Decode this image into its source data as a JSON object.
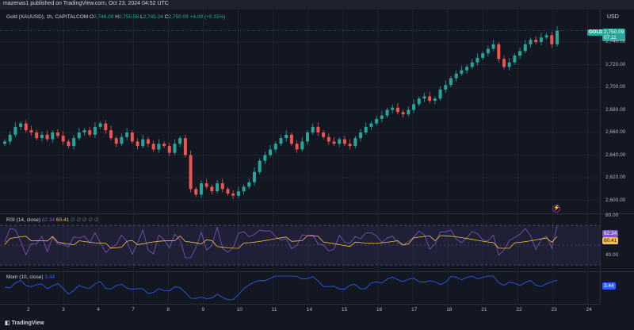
{
  "header": {
    "publisher": "mazenas1 published on TradingView.com, Oct 23, 2024 04:52 UTC"
  },
  "main_legend": {
    "symbol": "Gold (XAUUSD), 1h, CAPITALCOM",
    "o_label": "O",
    "o": "2,746.00",
    "h_label": "H",
    "h": "2,750.58",
    "l_label": "L",
    "l": "2,745.24",
    "c_label": "C",
    "c": "2,750.09",
    "change": "+4.09 (+0.15%)"
  },
  "currency": "USD",
  "symbol_tag": "GOLD",
  "current_price": "2,750.09",
  "countdown": "07:11",
  "price_axis": [
    "2,740.00",
    "2,720.00",
    "2,700.00",
    "2,680.00",
    "2,660.00",
    "2,640.00",
    "2,620.00",
    "2,600.00"
  ],
  "rsi": {
    "legend": "RSI (14, close)",
    "value1": "62.34",
    "value2": "60.41",
    "extra": "∅ ∅ ∅ ∅ ∅",
    "axis_top": "80.00",
    "axis_bottom": "40.00",
    "tag1": "62.34",
    "tag2": "60.41"
  },
  "mom": {
    "legend": "Mom (10, close)",
    "value": "3.44",
    "tag": "3.44"
  },
  "time_axis": [
    "2",
    "3",
    "4",
    "7",
    "8",
    "9",
    "10",
    "11",
    "14",
    "15",
    "16",
    "17",
    "18",
    "21",
    "22",
    "23",
    "24"
  ],
  "footer": {
    "brand": "TradingView"
  },
  "colors": {
    "up": "#26a69a",
    "down": "#ef5350",
    "rsi": "#7e57c2",
    "rsi_ma": "#f7c242",
    "mom": "#2962ff"
  },
  "chart_data": {
    "type": "candlestick",
    "prices": [
      2652,
      2658,
      2665,
      2668,
      2662,
      2660,
      2655,
      2658,
      2654,
      2660,
      2657,
      2652,
      2648,
      2655,
      2660,
      2662,
      2658,
      2665,
      2668,
      2662,
      2655,
      2650,
      2656,
      2660,
      2652,
      2648,
      2654,
      2650,
      2645,
      2650,
      2648,
      2642,
      2650,
      2655,
      2640,
      2610,
      2605,
      2615,
      2612,
      2608,
      2615,
      2610,
      2606,
      2604,
      2608,
      2612,
      2616,
      2625,
      2635,
      2640,
      2645,
      2650,
      2655,
      2658,
      2650,
      2645,
      2652,
      2660,
      2665,
      2660,
      2656,
      2652,
      2650,
      2654,
      2650,
      2648,
      2655,
      2660,
      2665,
      2668,
      2672,
      2675,
      2680,
      2682,
      2678,
      2676,
      2680,
      2685,
      2690,
      2692,
      2688,
      2690,
      2698,
      2702,
      2708,
      2712,
      2715,
      2718,
      2722,
      2726,
      2730,
      2734,
      2738,
      2725,
      2718,
      2722,
      2728,
      2732,
      2738,
      2742,
      2740,
      2744,
      2746,
      2738,
      2750
    ]
  }
}
